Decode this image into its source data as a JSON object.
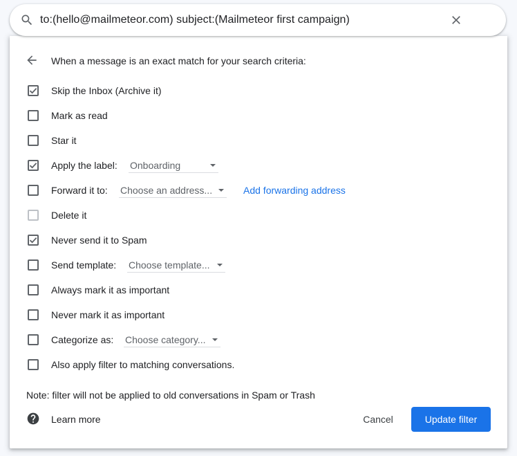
{
  "search": {
    "query": "to:(hello@mailmeteor.com) subject:(Mailmeteor first campaign)",
    "search_icon": "search-icon",
    "clear_icon": "close-icon"
  },
  "filter": {
    "heading": "When a message is an exact match for your search criteria:",
    "options": [
      {
        "label": "Skip the Inbox (Archive it)",
        "checked": true
      },
      {
        "label": "Mark as read",
        "checked": false
      },
      {
        "label": "Star it",
        "checked": false
      },
      {
        "label": "Apply the label:",
        "checked": true,
        "dropdown": "Onboarding"
      },
      {
        "label": "Forward it to:",
        "checked": false,
        "dropdown": "Choose an address...",
        "link": "Add forwarding address"
      },
      {
        "label": "Delete it",
        "checked": false,
        "disabled": true
      },
      {
        "label": "Never send it to Spam",
        "checked": true
      },
      {
        "label": "Send template:",
        "checked": false,
        "dropdown": "Choose template..."
      },
      {
        "label": "Always mark it as important",
        "checked": false
      },
      {
        "label": "Never mark it as important",
        "checked": false
      },
      {
        "label": "Categorize as:",
        "checked": false,
        "dropdown": "Choose category..."
      },
      {
        "label": "Also apply filter to matching conversations.",
        "checked": false
      }
    ],
    "note": "Note: filter will not be applied to old conversations in Spam or Trash",
    "learn_more": "Learn more",
    "cancel_label": "Cancel",
    "update_label": "Update filter"
  },
  "colors": {
    "accent": "#1a73e8",
    "checkbox": "#5f6368",
    "text": "#202124"
  }
}
